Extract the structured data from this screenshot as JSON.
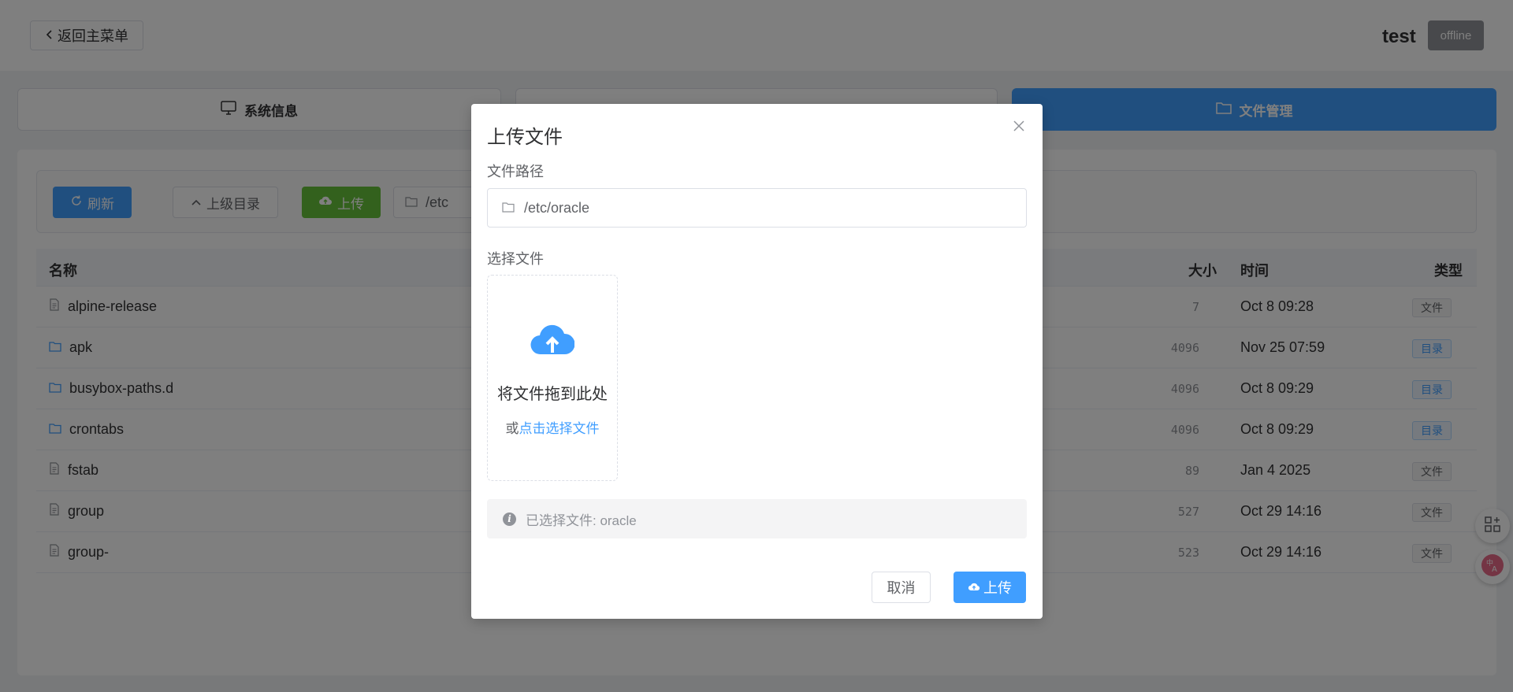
{
  "header": {
    "back_label": "返回主菜单",
    "device_name": "test",
    "status": "offline"
  },
  "tabs": [
    {
      "label": "系统信息",
      "icon": "monitor-icon"
    },
    {
      "label": "",
      "icon": "terminal-icon"
    },
    {
      "label": "文件管理",
      "icon": "folder-icon",
      "active": true
    }
  ],
  "toolbar": {
    "refresh_label": "刷新",
    "parent_label": "上级目录",
    "upload_label": "上传",
    "path_value": "/etc"
  },
  "table": {
    "headers": {
      "name": "名称",
      "size": "大小",
      "time": "时间",
      "type": "类型"
    },
    "rows": [
      {
        "name": "alpine-release",
        "size": "7",
        "time": "Oct 8 09:28",
        "type": "文件",
        "kind": "file"
      },
      {
        "name": "apk",
        "size": "4096",
        "time": "Nov 25 07:59",
        "type": "目录",
        "kind": "dir"
      },
      {
        "name": "busybox-paths.d",
        "size": "4096",
        "time": "Oct 8 09:29",
        "type": "目录",
        "kind": "dir"
      },
      {
        "name": "crontabs",
        "size": "4096",
        "time": "Oct 8 09:29",
        "type": "目录",
        "kind": "dir"
      },
      {
        "name": "fstab",
        "size": "89",
        "time": "Jan 4 2025",
        "type": "文件",
        "kind": "file"
      },
      {
        "name": "group",
        "size": "527",
        "time": "Oct 29 14:16",
        "type": "文件",
        "kind": "file"
      },
      {
        "name": "group-",
        "size": "523",
        "time": "Oct 29 14:16",
        "type": "文件",
        "kind": "file"
      }
    ]
  },
  "dialog": {
    "title": "上传文件",
    "path_label": "文件路径",
    "path_value": "/etc/oracle",
    "file_label": "选择文件",
    "drop_main": "将文件拖到此处",
    "drop_or": "或",
    "drop_link": "点击选择文件",
    "selected_text": "已选择文件: oracle",
    "cancel_label": "取消",
    "upload_label": "上传"
  },
  "colors": {
    "primary": "#409eff",
    "success": "#67c23a",
    "offline": "#909399"
  }
}
